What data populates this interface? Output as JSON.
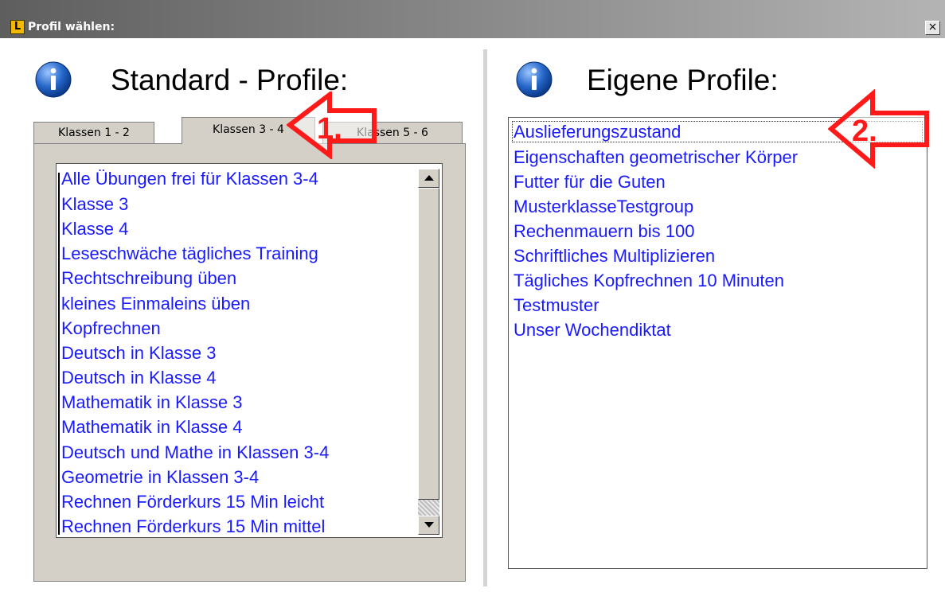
{
  "window": {
    "title": "Profil wählen:",
    "app_icon_letter": "L",
    "close_glyph": "×"
  },
  "left": {
    "heading": "Standard - Profile:",
    "tabs": [
      {
        "label": "Klassen 1 - 2",
        "active": false
      },
      {
        "label": "Klassen 3 - 4",
        "active": true
      },
      {
        "label": "Klassen 5 - 6",
        "active": false
      }
    ],
    "items": [
      "Alle Übungen frei für Klassen 3-4",
      "Klasse 3",
      "Klasse 4",
      "Leseschwäche tägliches Training",
      "Rechtschreibung üben",
      "kleines Einmaleins üben",
      "Kopfrechnen",
      "Deutsch in Klasse 3",
      "Deutsch in Klasse 4",
      "Mathematik in Klasse 3",
      "Mathematik in Klasse 4",
      "Deutsch und Mathe in Klassen 3-4",
      "Geometrie in Klassen 3-4",
      "Rechnen Förderkurs 15 Min leicht",
      "Rechnen Förderkurs 15 Min mittel"
    ]
  },
  "right": {
    "heading": "Eigene Profile:",
    "items": [
      "Auslieferungszustand",
      "Eigenschaften geometrischer Körper",
      "Futter für die Guten",
      "MusterklasseTestgroup",
      "Rechenmauern bis 100",
      "Schriftliches Multiplizieren",
      "Tägliches Kopfrechnen 10 Minuten",
      "Testmuster",
      "Unser Wochendiktat"
    ],
    "selected_index": 0
  },
  "annotations": {
    "first": "1.",
    "second": "2.",
    "color": "#ff1a1a"
  },
  "colors": {
    "item_text": "#1a1aff",
    "info_icon": "#1f5fbf"
  },
  "icons": {
    "info": "info-icon",
    "close": "close-icon",
    "scroll_up": "arrow-up-icon",
    "scroll_down": "arrow-down-icon",
    "annotation": "arrow-left-icon"
  }
}
